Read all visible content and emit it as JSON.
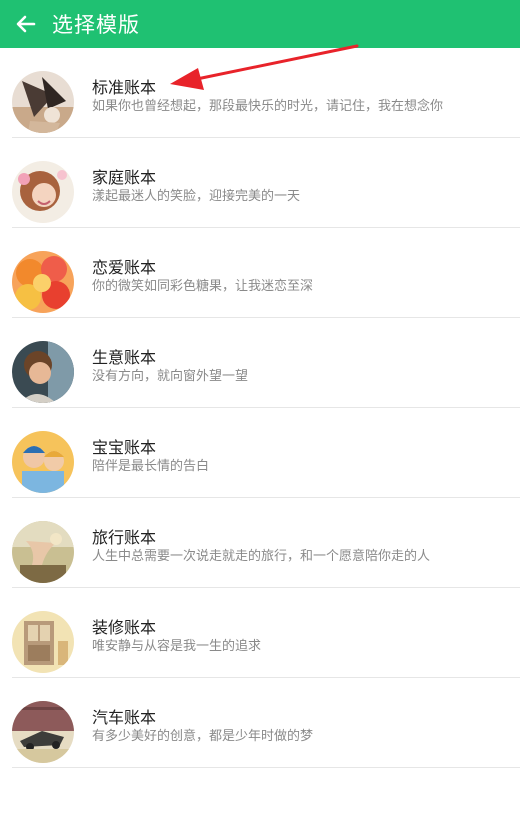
{
  "header": {
    "title": "选择模版",
    "back_icon": "arrow-left-icon",
    "color": "#1fc172"
  },
  "templates": [
    {
      "title": "标准账本",
      "desc": "如果你也曾经想起，那段最快乐的时光，请记住，我在想念你"
    },
    {
      "title": "家庭账本",
      "desc": "漾起最迷人的笑脸，迎接完美的一天"
    },
    {
      "title": "恋爱账本",
      "desc": "你的微笑如同彩色糖果，让我迷恋至深"
    },
    {
      "title": "生意账本",
      "desc": "没有方向，就向窗外望一望"
    },
    {
      "title": "宝宝账本",
      "desc": "陪伴是最长情的告白"
    },
    {
      "title": "旅行账本",
      "desc": "人生中总需要一次说走就走的旅行，和一个愿意陪你走的人"
    },
    {
      "title": "装修账本",
      "desc": "唯安静与从容是我一生的追求"
    },
    {
      "title": "汽车账本",
      "desc": "有多少美好的创意，都是少年时做的梦"
    }
  ],
  "annotation": {
    "arrow_color": "#e8232a"
  }
}
